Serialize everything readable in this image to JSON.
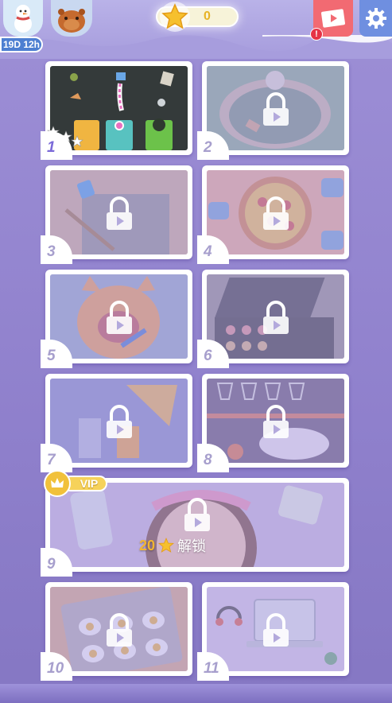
{
  "header": {
    "timer": "19D 12h",
    "star_count": "0",
    "alert_badge": "!",
    "icons": {
      "snowman": "snowman-avatar-icon",
      "capybara": "capybara-avatar-icon",
      "star": "star-icon",
      "video": "video-ad-icon",
      "settings": "gear-icon"
    }
  },
  "levels": [
    {
      "number": "1",
      "locked": false,
      "scene": "trash-sorting",
      "stars_earned": 0
    },
    {
      "number": "2",
      "locked": true,
      "scene": "fountain-cleaning"
    },
    {
      "number": "3",
      "locked": true,
      "scene": "grout-cleaning"
    },
    {
      "number": "4",
      "locked": true,
      "scene": "pizza-making"
    },
    {
      "number": "5",
      "locked": true,
      "scene": "cat-teeth-brushing"
    },
    {
      "number": "6",
      "locked": true,
      "scene": "makeup-palette"
    },
    {
      "number": "7",
      "locked": true,
      "scene": "juice-pouring"
    },
    {
      "number": "8",
      "locked": true,
      "scene": "wine-glasses-cat"
    },
    {
      "number": "9",
      "locked": true,
      "scene": "skincare-girl",
      "vip": true,
      "vip_label": "VIP",
      "unlock_cost": "20",
      "unlock_label": "解锁"
    },
    {
      "number": "10",
      "locked": true,
      "scene": "egg-tray"
    },
    {
      "number": "11",
      "locked": true,
      "scene": "laptop-desk"
    }
  ],
  "colors": {
    "background": "#9486d0",
    "card_border": "#ffffff",
    "star_gold": "#f2b531",
    "video_red": "#f26a72",
    "gear_blue": "#6f8fe0",
    "timer_blue": "#4d7fd1"
  }
}
